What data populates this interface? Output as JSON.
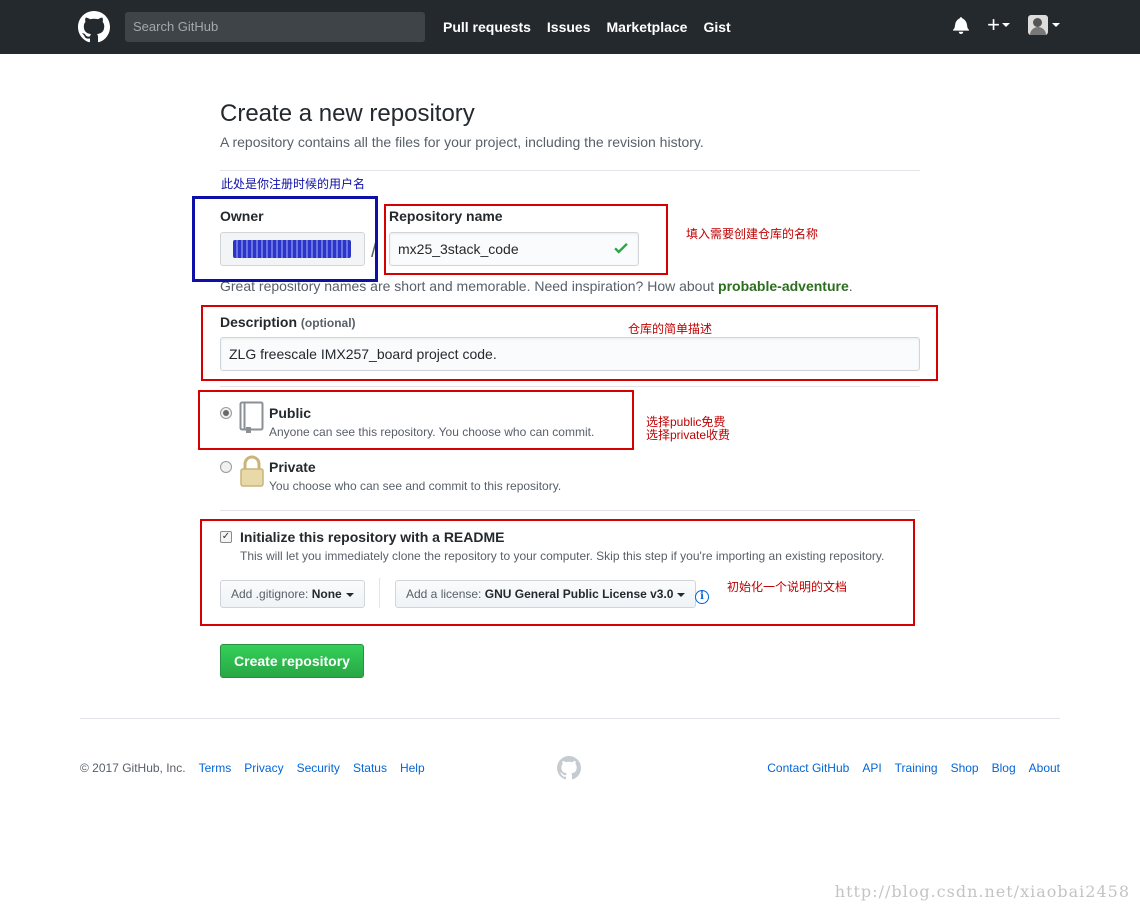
{
  "header": {
    "search_placeholder": "Search GitHub",
    "nav": [
      "Pull requests",
      "Issues",
      "Marketplace",
      "Gist"
    ],
    "plus_label": "+"
  },
  "page": {
    "title": "Create a new repository",
    "subtitle": "A repository contains all the files for your project, including the revision history."
  },
  "form": {
    "owner_label": "Owner",
    "owner_separator": "/",
    "repo_name_label": "Repository name",
    "repo_name_value": "mx25_3stack_code",
    "hint_prefix": "Great repository names are short and memorable. Need inspiration? How about ",
    "hint_suggestion": "probable-adventure",
    "hint_suffix": ".",
    "description_label": "Description",
    "description_optional": "(optional)",
    "description_value": "ZLG freescale IMX257_board project code.",
    "visibility": {
      "public_title": "Public",
      "public_desc": "Anyone can see this repository. You choose who can commit.",
      "private_title": "Private",
      "private_desc": "You choose who can see and commit to this repository.",
      "selected": "public"
    },
    "readme_title": "Initialize this repository with a README",
    "readme_desc": "This will let you immediately clone the repository to your computer. Skip this step if you're importing an existing repository.",
    "readme_checked": true,
    "gitignore_prefix": "Add .gitignore:",
    "gitignore_value": "None",
    "license_prefix": "Add a license:",
    "license_value": "GNU General Public License v3.0",
    "info_glyph": "i",
    "create_button": "Create repository"
  },
  "annotations": {
    "owner_note": "此处是你注册时候的用户名",
    "repo_note": "填入需要创建仓库的名称",
    "desc_note": "仓库的简单描述",
    "visibility_note_1": "选择public免费",
    "visibility_note_2": "选择private收费",
    "readme_note": "初始化一个说明的文档",
    "colors": {
      "red": "#d50000",
      "blue": "#0d0fa8"
    }
  },
  "footer": {
    "copyright": "© 2017 GitHub, Inc.",
    "left_links": [
      "Terms",
      "Privacy",
      "Security",
      "Status",
      "Help"
    ],
    "right_links": [
      "Contact GitHub",
      "API",
      "Training",
      "Shop",
      "Blog",
      "About"
    ]
  },
  "watermark": "http://blog.csdn.net/xiaobai2458"
}
